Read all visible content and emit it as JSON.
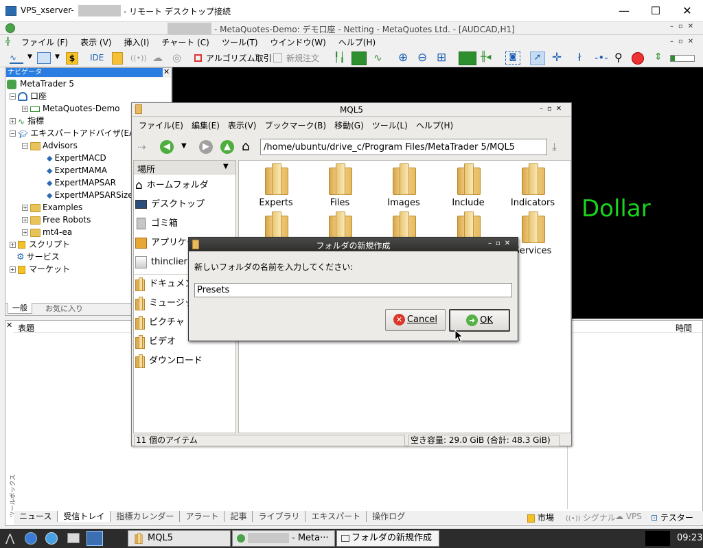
{
  "rdp": {
    "title": "VPS_xserver-",
    "title_suffix": "- リモート デスクトップ接続",
    "min": "—",
    "max": "☐",
    "close": "✕"
  },
  "mt5": {
    "title": "- MetaQuotes-Demo: デモ口座 - Netting - MetaQuotes Ltd. - [AUDCAD,H1]",
    "menu": [
      "ファイル (F)",
      "表示 (V)",
      "挿入(I)",
      "チャート (C)",
      "ツール(T)",
      "ウインドウ(W)",
      "ヘルプ(H)"
    ],
    "toolbar": {
      "ide": "IDE",
      "algo": "アルゴリズム取引",
      "new_order": "新規注文"
    },
    "navigator": {
      "title": "ナビゲータ",
      "root": "MetaTrader 5",
      "account": "口座",
      "account_item": "MetaQuotes-Demo",
      "indicators": "指標",
      "ea": "エキスパートアドバイザ(EA)",
      "advisors": "Advisors",
      "experts": [
        "ExpertMACD",
        "ExpertMAMA",
        "ExpertMAPSAR",
        "ExpertMAPSARSizeO"
      ],
      "examples": "Examples",
      "free_robots": "Free Robots",
      "mt4ea": "mt4-ea",
      "scripts": "スクリプト",
      "services": "サービス",
      "market": "マーケット",
      "tabs": [
        "一般",
        "お気に入り"
      ]
    },
    "chart_text": "Dollar",
    "toolbox": {
      "side_label": "ツールボックス",
      "col_subject": "表題",
      "col_time": "時間",
      "tabs": [
        "ニュース",
        "受信トレイ",
        "指標カレンダー",
        "アラート",
        "記事",
        "ライブラリ",
        "エキスパート",
        "操作ログ"
      ],
      "status": [
        "市場",
        "シグナル",
        "VPS",
        "テスター"
      ]
    }
  },
  "filemgr": {
    "title": "MQL5",
    "menu": [
      "ファイル(E)",
      "編集(E)",
      "表示(V)",
      "ブックマーク(B)",
      "移動(G)",
      "ツール(L)",
      "ヘルプ(H)"
    ],
    "path": "/home/ubuntu/drive_c/Program Files/MetaTrader 5/MQL5",
    "places_title": "場所",
    "places": [
      "ホームフォルダ",
      "デスクトップ",
      "ゴミ箱",
      "アプリケー",
      "thinclier",
      "ドキュメン",
      "ミュージッ",
      "ピクチャ",
      "ビデオ",
      "ダウンロード"
    ],
    "folders": [
      "Experts",
      "Files",
      "Images",
      "Include",
      "Indicators",
      "",
      "",
      "",
      "",
      "Services"
    ],
    "status_left": "11 個のアイテム",
    "status_right": "空き容量: 29.0 GiB (合計: 48.3 GiB)"
  },
  "dialog": {
    "title": "フォルダの新規作成",
    "prompt": "新しいフォルダの名前を入力してください:",
    "value": "Presets",
    "cancel": "Cancel",
    "ok": "OK"
  },
  "taskbar": {
    "items": [
      "MQL5",
      "- Meta···",
      "フォルダの新規作成"
    ],
    "time": "09:23"
  }
}
